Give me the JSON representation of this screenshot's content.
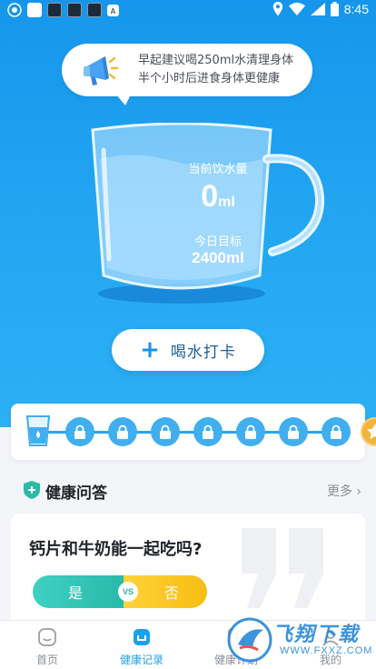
{
  "status_bar": {
    "time": "8:45",
    "notification_text": "A"
  },
  "tip": {
    "line1": "早起建议喝250ml水清理身体",
    "line2": "半个小时后进食身体更健康"
  },
  "glass": {
    "current_label": "当前饮水量",
    "current_value": "0",
    "current_unit": "ml",
    "goal_label": "今日目标",
    "goal_value": "2400ml"
  },
  "checkin": {
    "label": "喝水打卡"
  },
  "progress": {
    "completed": 0,
    "total": 8
  },
  "qa": {
    "title": "健康问答",
    "more": "更多",
    "question": "钙片和牛奶能一起吃吗?",
    "yes": "是",
    "vs": "VS",
    "no": "否"
  },
  "nav": {
    "items": [
      {
        "label": "首页",
        "icon": "home-icon"
      },
      {
        "label": "健康记录",
        "icon": "record-icon"
      },
      {
        "label": "健康计划",
        "icon": "plan-icon"
      },
      {
        "label": "我的",
        "icon": "profile-icon"
      }
    ]
  },
  "watermark": {
    "title": "飞翔下载",
    "url": "WWW.FXXZ.COM"
  },
  "colors": {
    "primary": "#1596ec",
    "accent_yes": "#27b8a9",
    "accent_no": "#f7bd12",
    "star": "#f5b23c"
  }
}
